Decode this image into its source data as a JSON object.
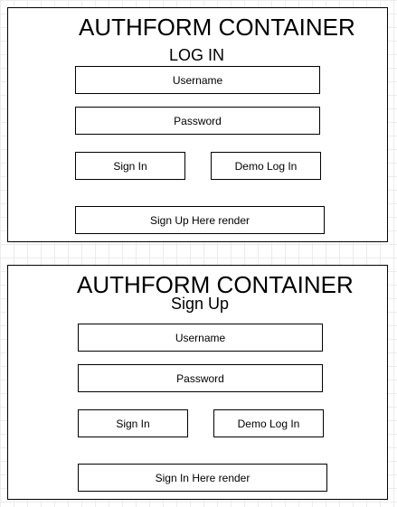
{
  "login_panel": {
    "container_title": "AUTHFORM CONTAINER",
    "heading": "LOG IN",
    "username_label": "Username",
    "password_label": "Password",
    "sign_in_label": "Sign In",
    "demo_login_label": "Demo Log In",
    "switch_label": "Sign Up Here render"
  },
  "signup_panel": {
    "container_title": "AUTHFORM CONTAINER",
    "heading": "Sign Up",
    "username_label": "Username",
    "password_label": "Password",
    "sign_in_label": "Sign In",
    "demo_login_label": "Demo Log In",
    "switch_label": "Sign In Here render"
  }
}
